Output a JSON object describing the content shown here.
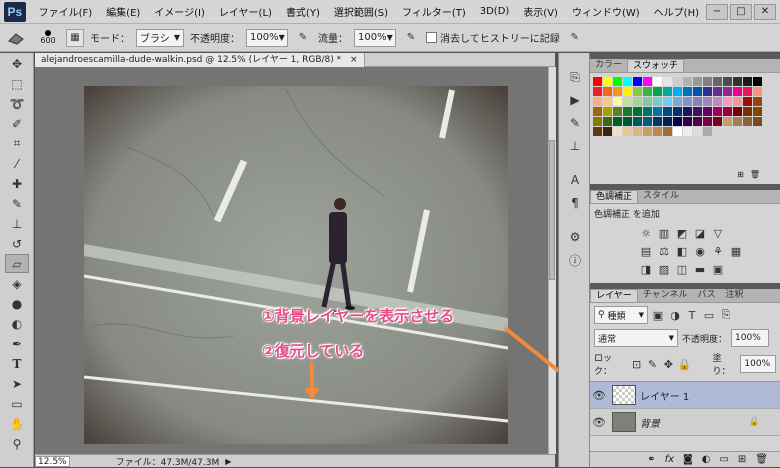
{
  "app": {
    "logo": "Ps"
  },
  "menubar": {
    "items": [
      "ファイル(F)",
      "編集(E)",
      "イメージ(I)",
      "レイヤー(L)",
      "書式(Y)",
      "選択範囲(S)",
      "フィルター(T)",
      "3D(D)",
      "表示(V)",
      "ウィンドウ(W)",
      "ヘルプ(H)"
    ]
  },
  "window_controls": [
    "−",
    "□",
    "✕"
  ],
  "options": {
    "brush_size": "600",
    "mode_label": "モード：",
    "mode_value": "ブラシ",
    "opacity_label": "不透明度：",
    "opacity_value": "100%",
    "flow_label": "流量：",
    "flow_value": "100%",
    "history_label": "消去してヒストリーに記録"
  },
  "document": {
    "tab_title": "alejandroescamilla-dude-walkin.psd @ 12.5% (レイヤー 1, RGB/8) *",
    "close": "×"
  },
  "status": {
    "zoom": "12.5%",
    "file_info": "ファイル：47.3M/47.3M"
  },
  "annotations": {
    "step1": "①背景レイヤーを表示させる",
    "step2": "②復元している"
  },
  "panels": {
    "color_tabs": [
      "カラー",
      "スウォッチ"
    ],
    "adjust_tabs": [
      "色調補正",
      "スタイル"
    ],
    "adjust_add": "色調補正 を追加",
    "layers_tabs": [
      "レイヤー",
      "チャンネル",
      "パス",
      "注釈"
    ],
    "filter_kind": "種類",
    "blend_mode": "通常",
    "opacity_label": "不透明度：",
    "opacity_value": "100%",
    "lock_label": "ロック：",
    "fill_label": "塗り：",
    "fill_value": "100%",
    "layers": [
      {
        "name": "レイヤー 1"
      },
      {
        "name": "背景"
      }
    ],
    "footer_icons": [
      "link-icon",
      "fx-icon",
      "mask-icon",
      "adjustment-icon",
      "folder-icon",
      "new-layer-icon",
      "trash-icon"
    ]
  },
  "colors": {
    "annotation": "#e84b8a",
    "arrow": "#f08a3c",
    "selected_layer": "#aebad6",
    "highlight_box": "#e3347f"
  },
  "swatch_palette": [
    "#ff0000",
    "#ffff00",
    "#00ff00",
    "#00ffff",
    "#0000ff",
    "#ff00ff",
    "#ffffff",
    "#e6e6e6",
    "#cccccc",
    "#b3b3b3",
    "#999999",
    "#808080",
    "#666666",
    "#4d4d4d",
    "#333333",
    "#1a1a1a",
    "#000000",
    "#ee1d24",
    "#f26522",
    "#f7941d",
    "#fff200",
    "#8dc63f",
    "#39b54a",
    "#00a651",
    "#00a99d",
    "#00aeef",
    "#0072bc",
    "#0054a6",
    "#2e3192",
    "#662d91",
    "#92278f",
    "#ec008c",
    "#ed145b",
    "#f69679",
    "#f9ad81",
    "#fdc689",
    "#fff799",
    "#c4df9b",
    "#a3d39c",
    "#82ca9c",
    "#7accc8",
    "#6dcff6",
    "#7da7d9",
    "#8393ca",
    "#8781bd",
    "#a186be",
    "#bd8cbf",
    "#f49ac2",
    "#f5989d",
    "#9e0b0f",
    "#a0410d",
    "#a36209",
    "#aba000",
    "#598527",
    "#1a7b30",
    "#007236",
    "#00746b",
    "#0076a3",
    "#004b80",
    "#003471",
    "#1b1464",
    "#440e62",
    "#630460",
    "#9e005d",
    "#9e0039",
    "#790000",
    "#7b2e00",
    "#7d4900",
    "#827b00",
    "#406618",
    "#005e20",
    "#005826",
    "#005952",
    "#005b7f",
    "#003663",
    "#002157",
    "#0d004c",
    "#32004b",
    "#4b0049",
    "#7b0046",
    "#7a0026",
    "#c69c6d",
    "#a67c52",
    "#8c6239",
    "#754c24",
    "#603913",
    "#3c2415",
    "#f0e1c0",
    "#e5c899",
    "#d9b77f",
    "#c9a063",
    "#bb8a4a",
    "#9c6f35",
    "#ffffff",
    "#eeeeee",
    "#dddddd",
    "#aaaaaa"
  ]
}
